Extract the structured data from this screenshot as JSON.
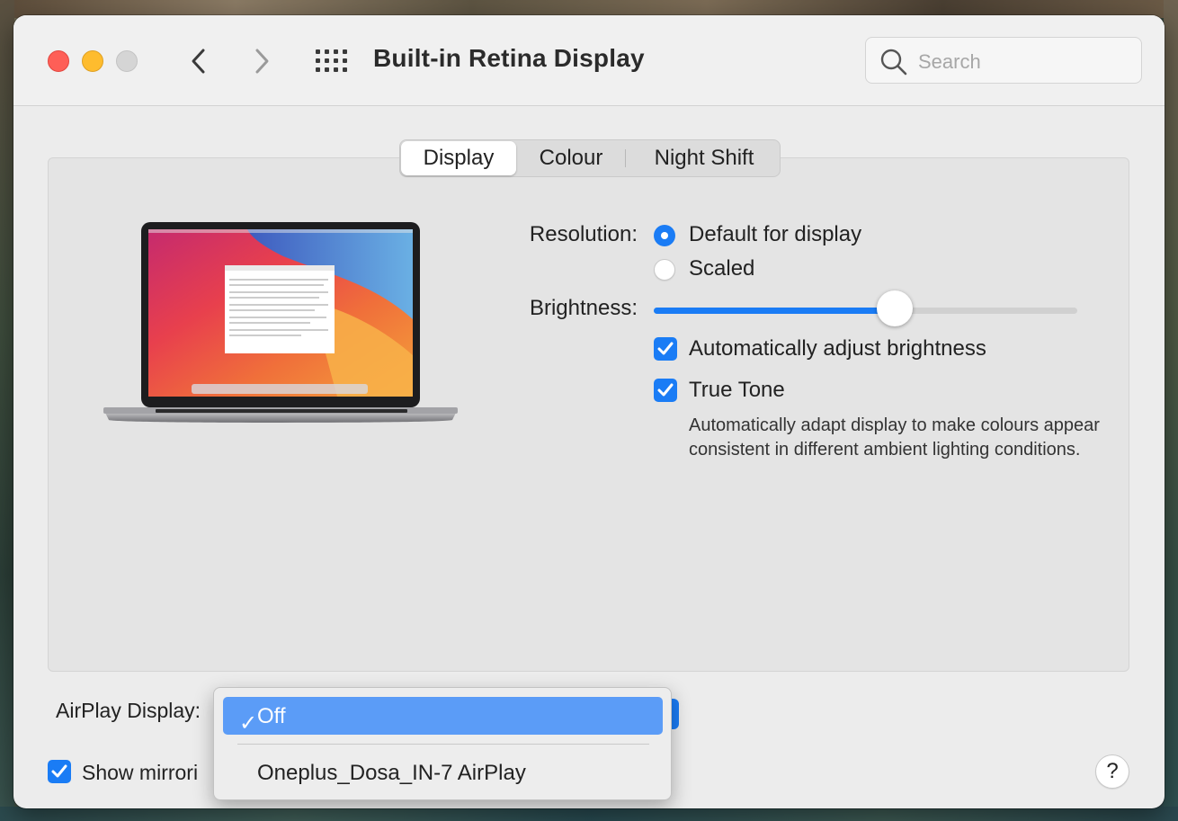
{
  "window": {
    "title": "Built-in Retina Display"
  },
  "search": {
    "placeholder": "Search"
  },
  "tabs": [
    {
      "label": "Display",
      "selected": true
    },
    {
      "label": "Colour",
      "selected": false
    },
    {
      "label": "Night Shift",
      "selected": false
    }
  ],
  "resolution": {
    "label": "Resolution:",
    "options": [
      {
        "label": "Default for display",
        "selected": true
      },
      {
        "label": "Scaled",
        "selected": false
      }
    ]
  },
  "brightness": {
    "label": "Brightness:",
    "value": 0.57
  },
  "auto_brightness": {
    "label": "Automatically adjust brightness",
    "checked": true
  },
  "true_tone": {
    "label": "True Tone",
    "checked": true,
    "description": "Automatically adapt display to make colours appear consistent in different ambient lighting conditions."
  },
  "airplay": {
    "label": "AirPlay Display:",
    "menu": {
      "selected": "Off",
      "check_glyph": "✓",
      "other_option": "Oneplus_Dosa_IN-7 AirPlay"
    }
  },
  "mirroring": {
    "label": "Show mirrori",
    "checked": true
  },
  "help": {
    "label": "?"
  },
  "colors": {
    "accent": "#1a7cf5",
    "menu_highlight": "#5b9cf7",
    "close": "#fe5f57",
    "minimize": "#febc2e"
  }
}
